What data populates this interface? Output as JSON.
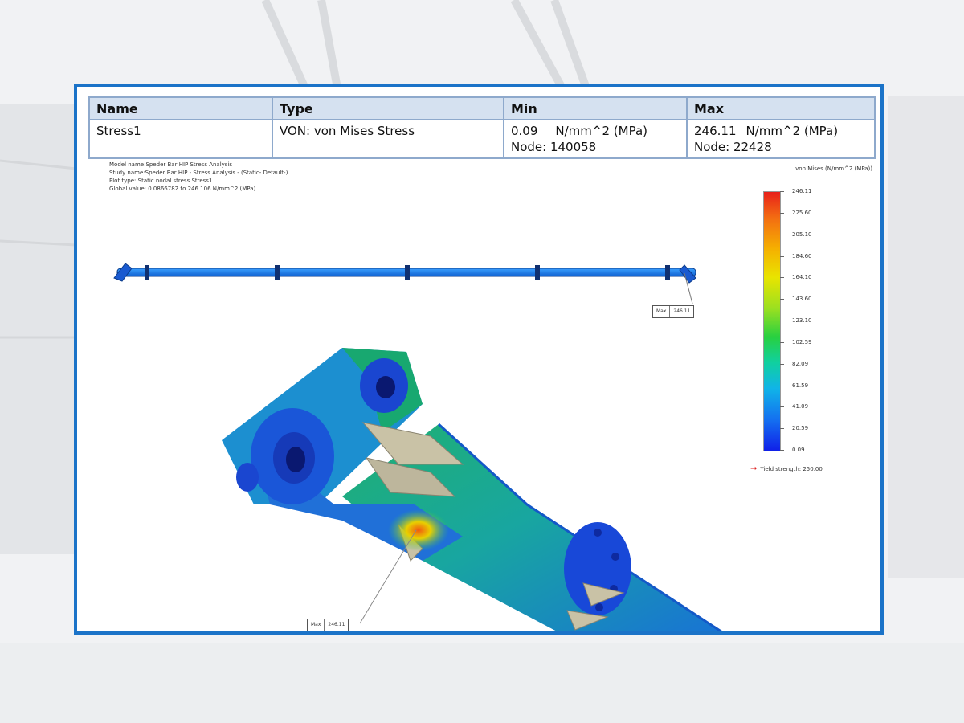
{
  "table": {
    "headers": [
      "Name",
      "Type",
      "Min",
      "Max"
    ],
    "row": {
      "name": "Stress1",
      "type": "VON: von Mises Stress",
      "min_value": "0.09",
      "min_unit": "N/mm^2 (MPa)",
      "min_node": "Node: 140058",
      "max_value": "246.11",
      "max_unit": "N/mm^2 (MPa)",
      "max_node": "Node: 22428"
    }
  },
  "study_info": {
    "line1": "Model name:Speder Bar HIP Stress Analysis",
    "line2": "Study name:Speder Bar HIP - Stress Analysis - (Static- Default-)",
    "line3": "Plot type: Static nodal stress Stress1",
    "line4": "Global value: 0.0866782 to 246.106 N/mm^2 (MPa)"
  },
  "legend": {
    "title": "von Mises (N/mm^2 (MPa))",
    "ticks": [
      "246.11",
      "225.60",
      "205.10",
      "184.60",
      "164.10",
      "143.60",
      "123.10",
      "102.59",
      "82.09",
      "61.59",
      "41.09",
      "20.59",
      "0.09"
    ],
    "yield_label": "Yield strength: 250.00"
  },
  "callouts": {
    "top_label": "Max",
    "top_value": "246.11",
    "bottom_label": "Max",
    "bottom_value": "246.11"
  },
  "colors": {
    "frame_border": "#1b73c8",
    "header_bg": "#d5e1f0",
    "stress_low": "#1020e8",
    "stress_high": "#e8201a"
  }
}
